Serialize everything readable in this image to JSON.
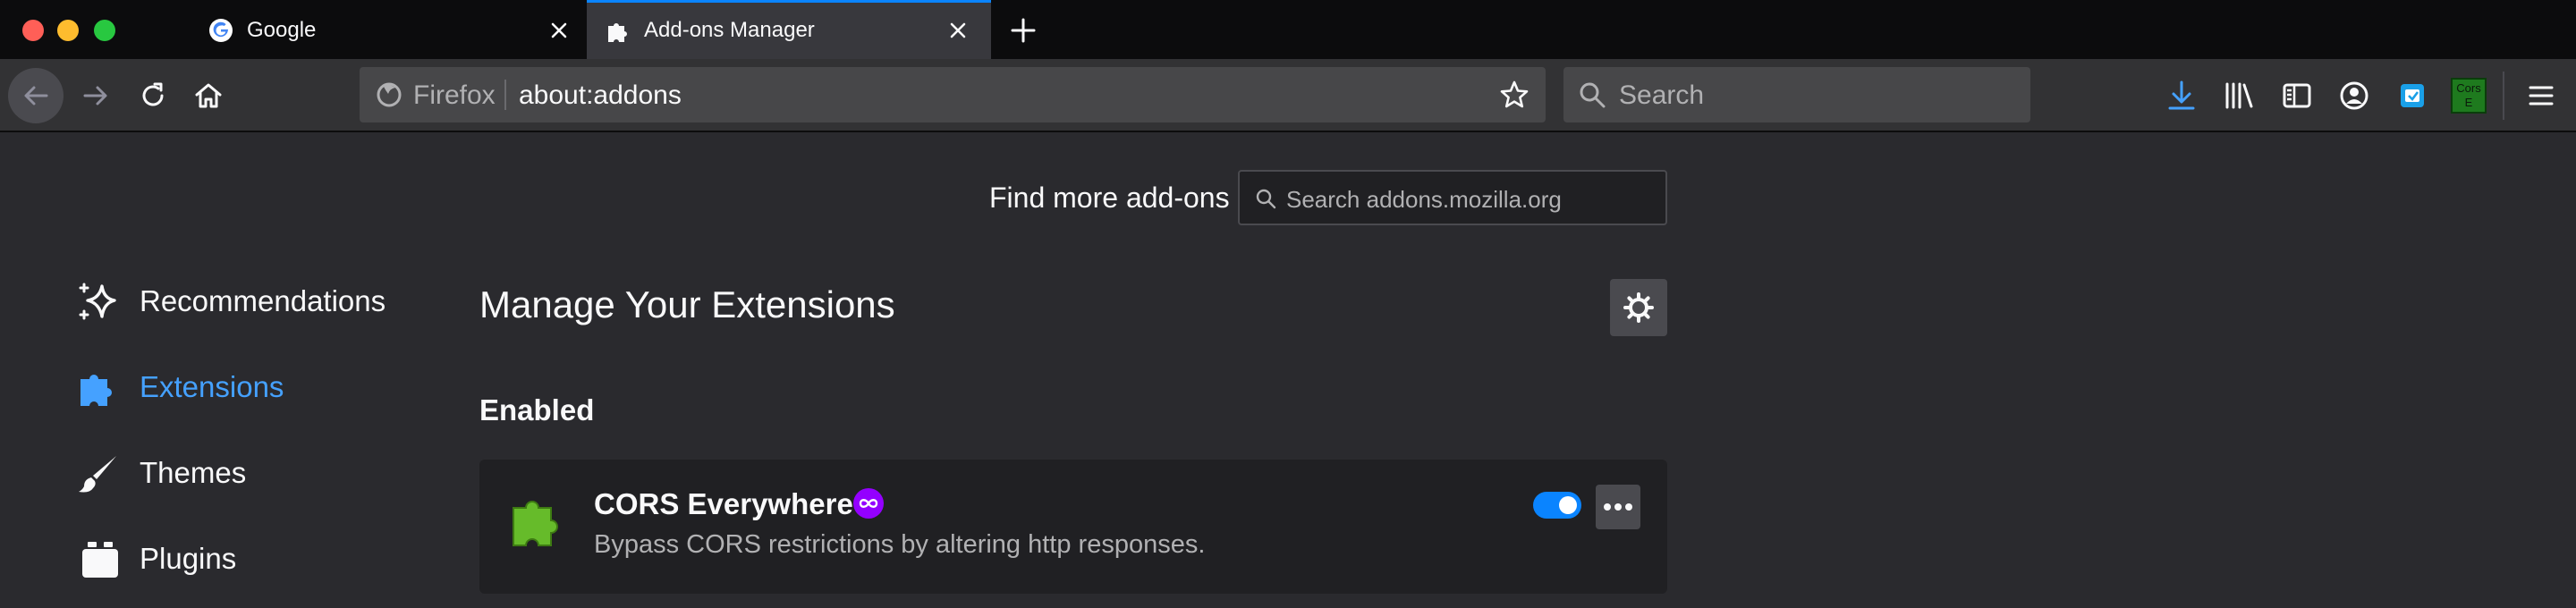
{
  "window": {
    "tabs": [
      {
        "title": "Google",
        "icon": "google-icon",
        "active": false
      },
      {
        "title": "Add-ons Manager",
        "icon": "puzzle-icon",
        "active": true
      }
    ]
  },
  "navbar": {
    "url_identity": "Firefox",
    "url": "about:addons",
    "search_placeholder": "Search",
    "toolbar_icons": [
      "download-icon",
      "library-icon",
      "sidebar-icon",
      "account-icon",
      "extension-icon",
      "cors-everywhere-icon",
      "hamburger-menu-icon"
    ],
    "cors_badge_text": "Cors E"
  },
  "content": {
    "find_more_label": "Find more add-ons",
    "amo_search_placeholder": "Search addons.mozilla.org",
    "categories": [
      {
        "label": "Recommendations",
        "icon": "sparkle-icon",
        "selected": false
      },
      {
        "label": "Extensions",
        "icon": "puzzle-icon",
        "selected": true
      },
      {
        "label": "Themes",
        "icon": "brush-icon",
        "selected": false
      },
      {
        "label": "Plugins",
        "icon": "plugin-icon",
        "selected": false
      }
    ],
    "page_title": "Manage Your Extensions",
    "section_heading": "Enabled",
    "addons": [
      {
        "name": "CORS Everywhere",
        "description": "Bypass CORS restrictions by altering http responses.",
        "enabled": true,
        "recommended": true
      }
    ]
  },
  "colors": {
    "accent": "#0a84ff",
    "selected_category": "#45a1ff",
    "recommended_badge": "#9400ff",
    "background": "#2a2a2e"
  }
}
